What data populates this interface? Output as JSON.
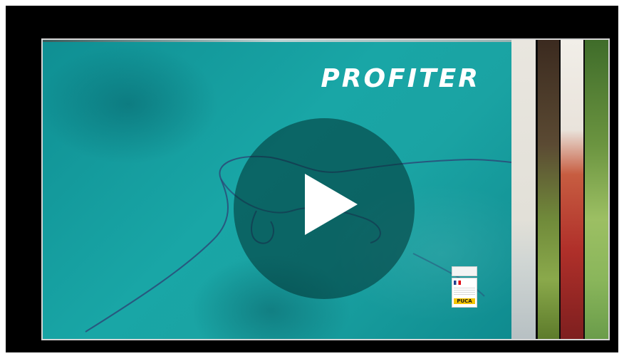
{
  "video": {
    "title": "PROFITER",
    "play_button_label": "",
    "badge": {
      "top_text": "",
      "label": "PUCA"
    },
    "colors": {
      "water": "#17a3a3",
      "overlay": "#003232",
      "title": "#ffffff",
      "badge_label_bg": "#f5c400"
    },
    "icons": {
      "play": "play-icon"
    }
  }
}
